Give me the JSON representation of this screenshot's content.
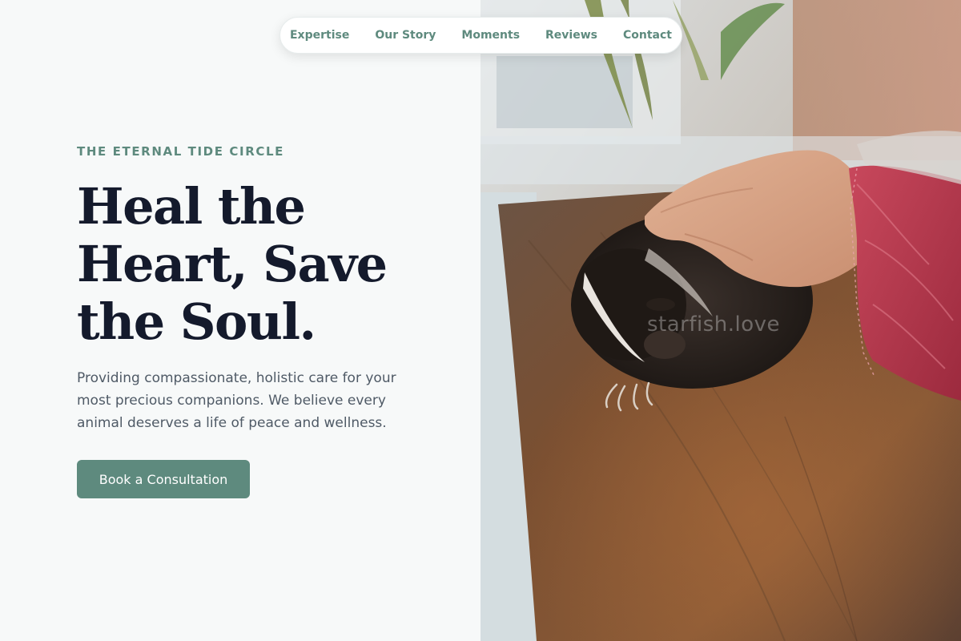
{
  "nav": {
    "links": [
      "Expertise",
      "Our Story",
      "Moments",
      "Reviews",
      "Contact"
    ]
  },
  "hero": {
    "eyebrow": "THE ETERNAL TIDE CIRCLE",
    "title_lines": [
      "Heal the",
      "Heart, Save",
      "the Soul."
    ],
    "subtitle": "Providing compassionate, holistic care for your most precious companions. We believe every animal deserves a life of peace and wellness.",
    "cta_label": "Book a Consultation"
  },
  "photo": {
    "subject": "hand-petting-skunk-on-wooden-table",
    "watermark": "starfish.love"
  },
  "colors": {
    "accent": "#5e8a7e",
    "heading": "#141a2c",
    "body_text": "#4f5a66",
    "background": "#f7f9f9"
  }
}
